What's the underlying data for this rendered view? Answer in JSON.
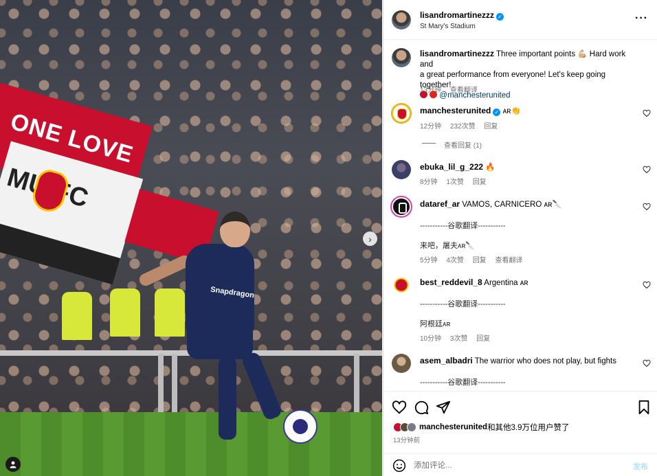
{
  "post": {
    "author": "lisandromartinezzz",
    "location": "St Mary's Stadium",
    "more_icon": "more-icon",
    "caption_user": "lisandromartinezzz",
    "caption_line1": "Three important points 💪🏼 Hard work and",
    "caption_line2": "a great performance from everyone! Let's keep going together!",
    "caption_mention": "@manchesterunited",
    "caption_time": "13分钟",
    "caption_translate": "查看翻译"
  },
  "comments": [
    {
      "user": "manchesterunited",
      "verified": true,
      "text": "ᴀʀ👏",
      "time": "12分钟",
      "likes": "232次赞",
      "reply": "回复",
      "view_replies": "查看回复 (1)"
    },
    {
      "user": "ebuka_lil_g_222",
      "text": "🔥",
      "time": "8分钟",
      "likes": "1次赞",
      "reply": "回复"
    },
    {
      "user": "dataref_ar",
      "text": "VAMOS, CARNICERO ᴀʀ🔪",
      "translation_header": "-----------谷歌翻译-----------",
      "translation": "来吧，屠夫ᴀʀ🔪",
      "time": "5分钟",
      "likes": "4次赞",
      "reply": "回复",
      "translate": "查看翻译"
    },
    {
      "user": "best_reddevil_8",
      "text": "Argentina ᴀʀ",
      "translation_header": "-----------谷歌翻译-----------",
      "translation": "阿根廷ᴀʀ",
      "time": "10分钟",
      "likes": "3次赞",
      "reply": "回复"
    },
    {
      "user": "asem_albadri",
      "text": "The warrior who does not play, but fights",
      "translation_header": "-----------谷歌翻译-----------"
    }
  ],
  "likes": {
    "user": "manchesterunited",
    "tail": "和其他3.9万位用户赞了",
    "posted": "13分钟前"
  },
  "composer": {
    "placeholder": "添加评论...",
    "post_label": "发布"
  },
  "photo": {
    "banner_text_1": "ONE LOVE",
    "banner_text_2": "MU FC",
    "sponsor": "Snapdragon"
  },
  "colors": {
    "accent": "#0095f6",
    "mention_link": "#00376b",
    "muted": "#737373",
    "mu_red": "#c8102e"
  }
}
